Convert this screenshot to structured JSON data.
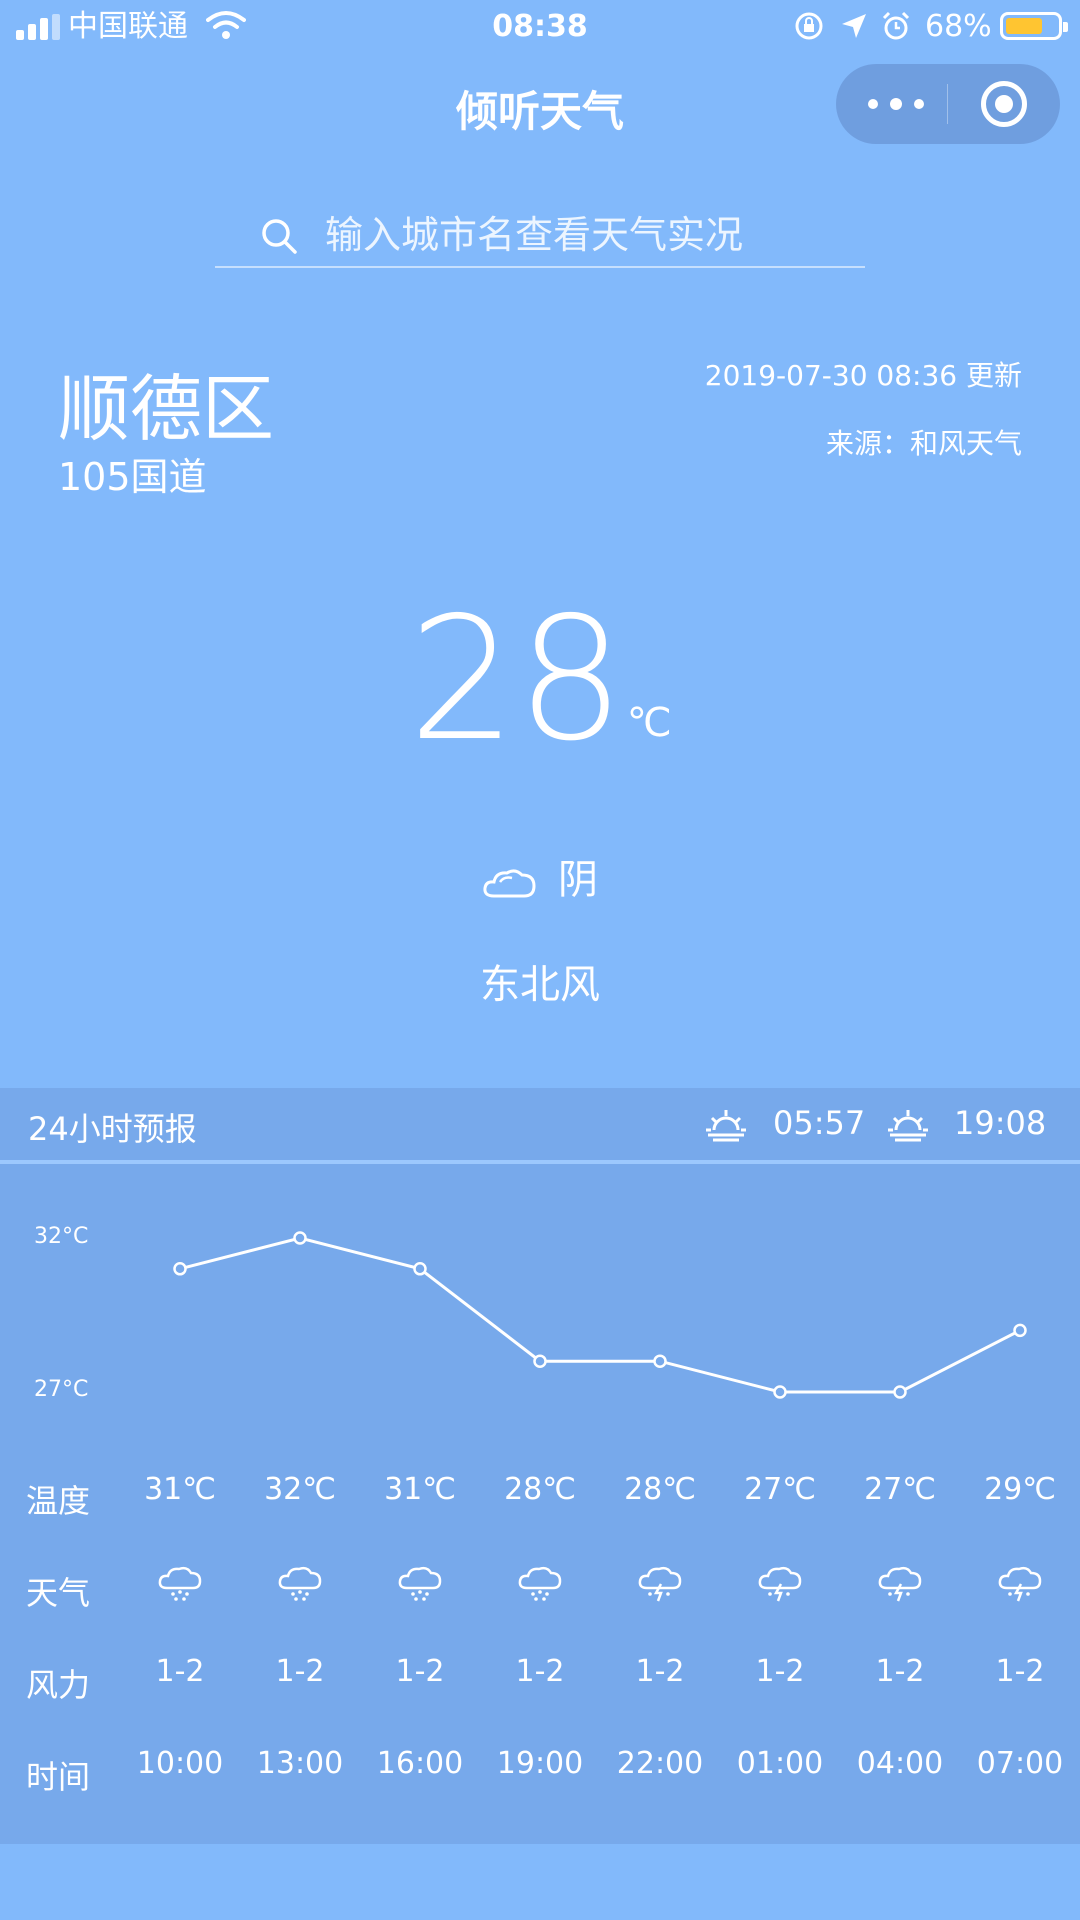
{
  "status_bar": {
    "carrier": "中国联通",
    "time": "08:38",
    "battery": "68%",
    "battery_level": 0.68
  },
  "nav": {
    "title": "倾听天气"
  },
  "search": {
    "placeholder": "输入城市名查看天气实况"
  },
  "location": {
    "city": "顺德区",
    "street": "105国道"
  },
  "meta": {
    "updated": "2019-07-30 08:36 更新",
    "source": "来源：和风天气"
  },
  "current": {
    "temperature": "28",
    "unit": "℃",
    "condition": "阴",
    "condition_icon": "cloud-icon",
    "wind": "东北风"
  },
  "forecast": {
    "title": "24小时预报",
    "sunrise": "05:57",
    "sunset": "19:08",
    "row_labels": {
      "temp": "温度",
      "weather": "天气",
      "wind": "风力",
      "time": "时间"
    },
    "y_ticks": [
      "32°C",
      "27°C"
    ],
    "hours": [
      {
        "time": "10:00",
        "temp": "31℃",
        "temp_value": 31,
        "wind": "1-2",
        "icon": "rain-cloud-icon"
      },
      {
        "time": "13:00",
        "temp": "32℃",
        "temp_value": 32,
        "wind": "1-2",
        "icon": "rain-cloud-icon"
      },
      {
        "time": "16:00",
        "temp": "31℃",
        "temp_value": 31,
        "wind": "1-2",
        "icon": "rain-cloud-icon"
      },
      {
        "time": "19:00",
        "temp": "28℃",
        "temp_value": 28,
        "wind": "1-2",
        "icon": "rain-cloud-icon"
      },
      {
        "time": "22:00",
        "temp": "28℃",
        "temp_value": 28,
        "wind": "1-2",
        "icon": "thunder-rain-icon"
      },
      {
        "time": "01:00",
        "temp": "27℃",
        "temp_value": 27,
        "wind": "1-2",
        "icon": "thunder-rain-icon"
      },
      {
        "time": "04:00",
        "temp": "27℃",
        "temp_value": 27,
        "wind": "1-2",
        "icon": "thunder-rain-icon"
      },
      {
        "time": "07:00",
        "temp": "29℃",
        "temp_value": 29,
        "wind": "1-2",
        "icon": "thunder-rain-icon"
      }
    ]
  },
  "chart_data": {
    "type": "line",
    "x": [
      "10:00",
      "13:00",
      "16:00",
      "19:00",
      "22:00",
      "01:00",
      "04:00",
      "07:00"
    ],
    "series": [
      {
        "values": [
          31,
          32,
          31,
          28,
          28,
          27,
          27,
          29
        ]
      }
    ],
    "ylim": [
      27,
      32
    ],
    "y_tick_labels": [
      "32°C",
      "27°C"
    ],
    "grid": false
  }
}
